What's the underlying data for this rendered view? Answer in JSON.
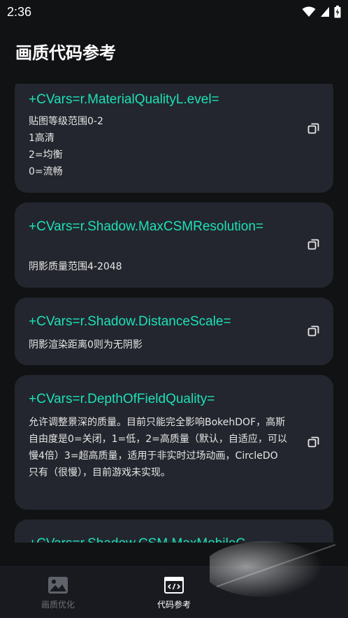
{
  "status_bar": {
    "time": "2:36"
  },
  "header": {
    "title": "画质代码参考"
  },
  "cards": [
    {
      "title": "+CVars=r.MaterialQualityL.evel=",
      "description": "贴图等级范围0-2\n1高清\n2=均衡\n0=流畅"
    },
    {
      "title": "+CVars=r.Shadow.MaxCSMResolution=",
      "description": "阴影质量范围4-2048"
    },
    {
      "title": "+CVars=r.Shadow.DistanceScale=",
      "description": "阴影渲染距离0则为无阴影"
    },
    {
      "title": "+CVars=r.DepthOfFieldQuality=",
      "description": "允许调整景深的质量。目前只能完全影响BokehDOF，高斯自由度是0=关闭，1=低，2=高质量（默认，自适应，可以慢4倍）3=超高质量，适用于非实时过场动画，CircleDO只有（很慢），目前游戏未实现。"
    },
    {
      "title": "+CVars=r.Shadow.CSM.MaxMobileC",
      "description": ""
    }
  ],
  "bottom_nav": {
    "items": [
      {
        "label": "画质优化"
      },
      {
        "label": "代码参考"
      }
    ]
  },
  "colors": {
    "background": "#111214",
    "card": "#23262e",
    "accent": "#1ee0b8",
    "nav_inactive": "#6e7178"
  },
  "icons": {
    "copy": "copy-icon",
    "nav_image": "image-icon",
    "nav_code": "code-icon"
  }
}
